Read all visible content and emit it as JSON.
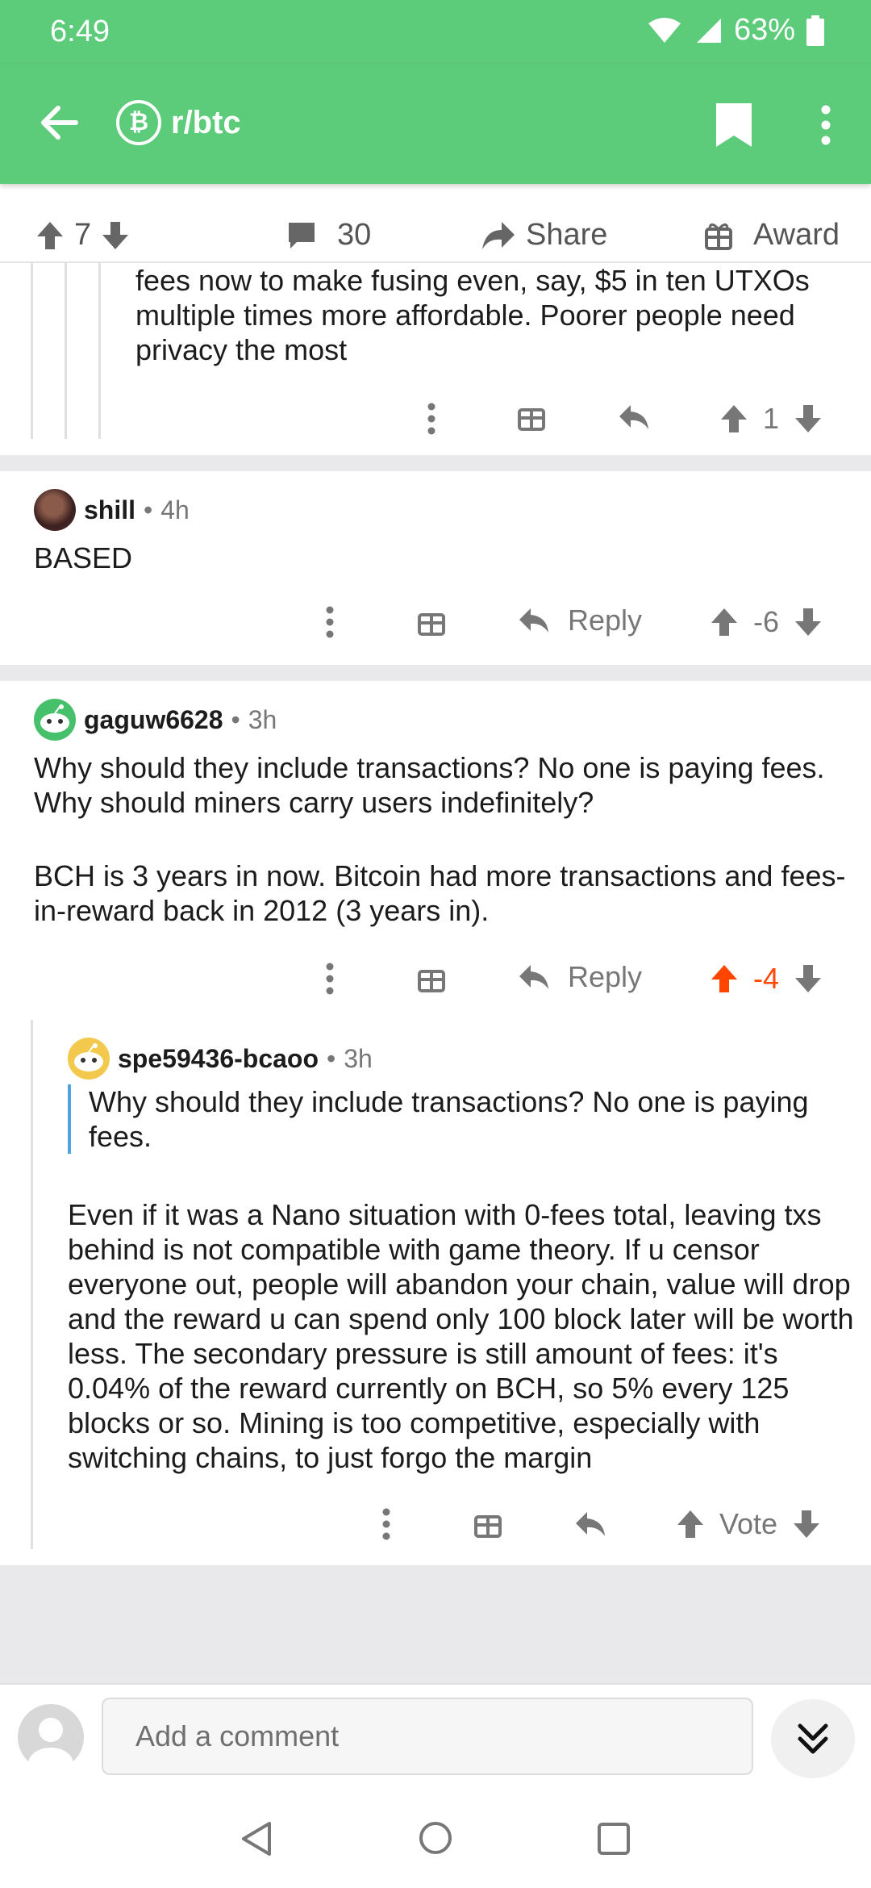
{
  "status": {
    "time": "6:49",
    "battery": "63%"
  },
  "header": {
    "subreddit": "r/btc"
  },
  "post_bar": {
    "upvotes": "7",
    "comments": "30",
    "share_label": "Share",
    "award_label": "Award"
  },
  "comments": [
    {
      "text": "fees now to make fusing even, say, $5 in ten UTXOs multiple times more affordable. Poorer people need privacy the most",
      "score": "1"
    },
    {
      "author": "shill",
      "age": "4h",
      "text": "BASED",
      "reply_label": "Reply",
      "score": "-6"
    },
    {
      "author": "gaguw6628",
      "age": "3h",
      "paragraphs": [
        "Why should they include transactions? No one is paying fees. Why should miners carry users indefinitely?",
        "BCH is 3 years in now. Bitcoin had more transactions and fees-in-reward back in 2012 (3 years in)."
      ],
      "reply_label": "Reply",
      "score": "-4"
    },
    {
      "author": "spe59436-bcaoo",
      "age": "3h",
      "quote": "Why should they include transactions? No one is paying fees.",
      "text": "Even if it was a Nano situation with 0-fees total, leaving txs behind is not compatible with game theory. If u censor everyone out, people will abandon your chain, value will drop and the reward u can spend only 100 block later will be worth less. The secondary pressure is still amount of fees: it's 0.04% of the reward currently on BCH, so 5% every 125 blocks or so. Mining is too competitive, especially with switching chains, to just forgo the margin",
      "score": "Vote"
    }
  ],
  "composer": {
    "placeholder": "Add a comment"
  },
  "colors": {
    "brand": "#5ccb7a",
    "upvote_active": "#ff4500",
    "quote_bar": "#4da6e0"
  }
}
